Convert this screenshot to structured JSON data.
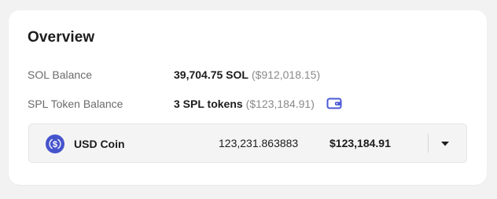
{
  "overview": {
    "title": "Overview",
    "sol_balance": {
      "label": "SOL Balance",
      "amount": "39,704.75 SOL",
      "usd": "($912,018.15)"
    },
    "spl_balance": {
      "label": "SPL Token Balance",
      "amount": "3 SPL tokens",
      "usd": "($123,184.91)",
      "icon": "wallet-icon"
    },
    "token_row": {
      "icon": "usdc-coin-icon",
      "name": "USD Coin",
      "amount": "123,231.863883",
      "usd": "$123,184.91",
      "toggle_icon": "chevron-down-icon"
    }
  },
  "colors": {
    "background": "#f2f2f2",
    "card": "#ffffff",
    "accent": "#4b5ad6",
    "usdc": "#4654cc"
  }
}
